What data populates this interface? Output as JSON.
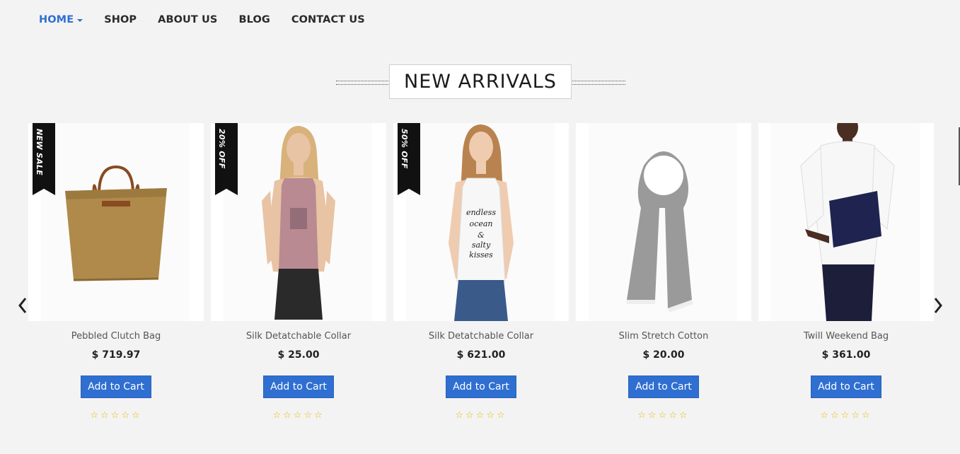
{
  "nav": {
    "items": [
      {
        "label": "HOME",
        "active": true
      },
      {
        "label": "SHOP",
        "active": false
      },
      {
        "label": "ABOUT US",
        "active": false
      },
      {
        "label": "BLOG",
        "active": false
      },
      {
        "label": "CONTACT US",
        "active": false
      }
    ]
  },
  "section": {
    "title": "NEW ARRIVALS"
  },
  "carousel": {
    "prev_icon": "‹",
    "next_icon": "›",
    "products": [
      {
        "name": "Pebbled Clutch Bag",
        "price": "$ 719.97",
        "button": "Add to Cart",
        "badge": "NEW SALE",
        "rating": "☆☆☆☆☆",
        "image": "tan-tote-bag"
      },
      {
        "name": "Silk Detatchable Collar",
        "price": "$ 25.00",
        "button": "Add to Cart",
        "badge": "20% OFF",
        "rating": "☆☆☆☆☆",
        "image": "woman-pink-tank-top"
      },
      {
        "name": "Silk Detatchable Collar",
        "price": "$ 621.00",
        "button": "Add to Cart",
        "badge": "50% OFF",
        "rating": "☆☆☆☆☆",
        "image": "woman-white-tank-top"
      },
      {
        "name": "Slim Stretch Cotton",
        "price": "$ 20.00",
        "button": "Add to Cart",
        "badge": "",
        "rating": "☆☆☆☆☆",
        "image": "grey-scarf"
      },
      {
        "name": "Twill Weekend Bag",
        "price": "$ 361.00",
        "button": "Add to Cart",
        "badge": "",
        "rating": "☆☆☆☆☆",
        "image": "man-navy-clutch"
      }
    ]
  },
  "colors": {
    "accent": "#2f6fd1",
    "star": "#e6b800",
    "ribbon": "#111111"
  }
}
